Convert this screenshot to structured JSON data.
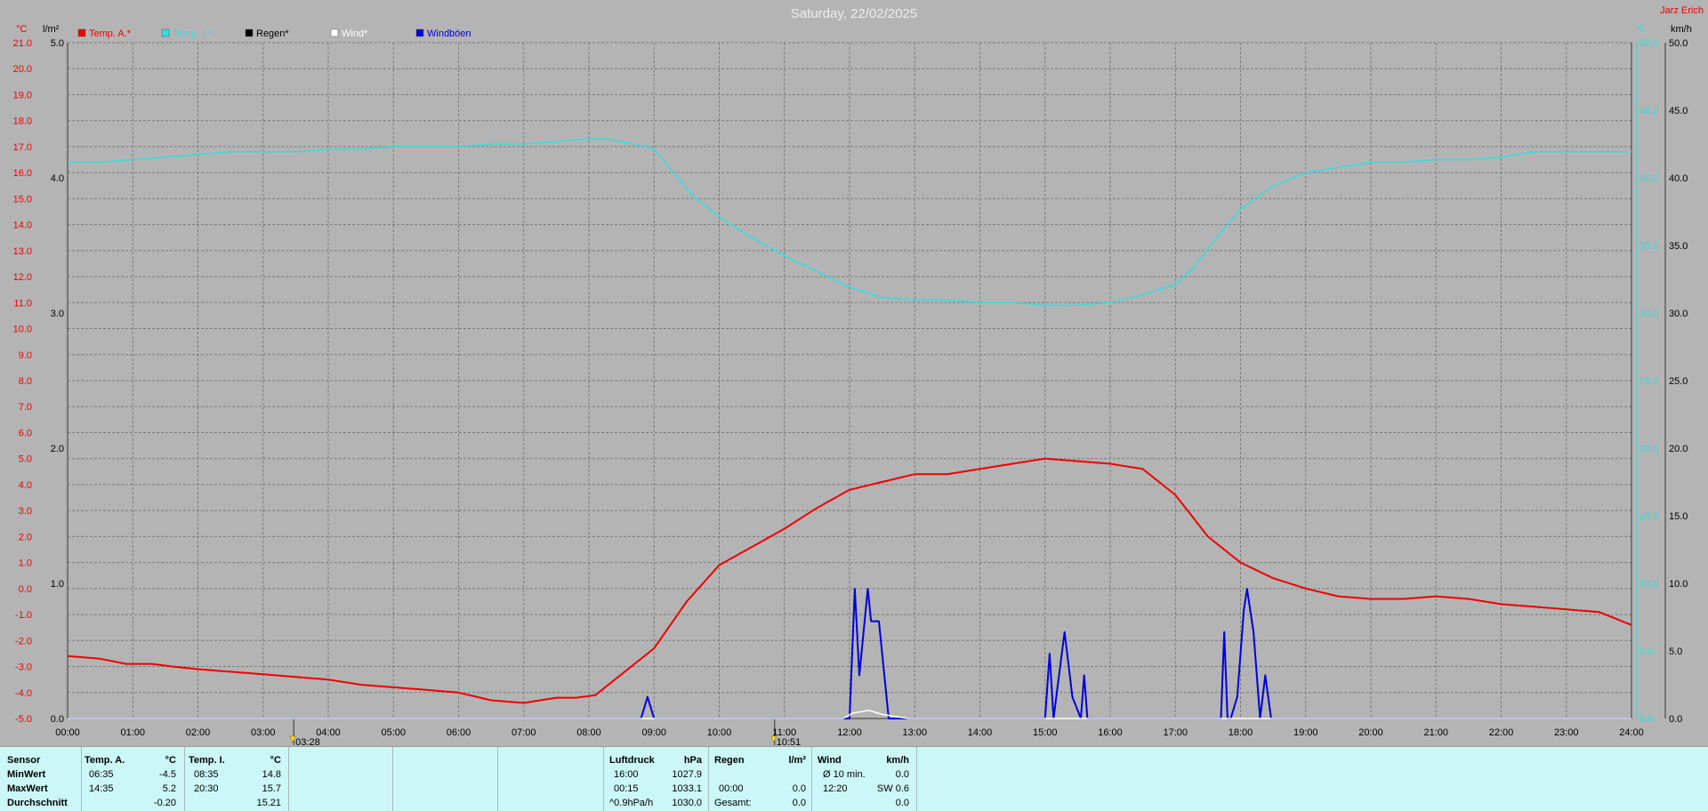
{
  "title": "Saturday, 22/02/2025",
  "corner_label": "Jarz Erich",
  "colors": {
    "background": "#b4b4b4",
    "grid": "#7c7c7c",
    "temp_outdoor": "#ee0000",
    "temp_indoor": "#33dddd",
    "rain": "#000000",
    "wind": "#ffffff",
    "gusts": "#0000dd",
    "stats_panel": "#ccf7f7"
  },
  "chart_data": {
    "type": "line",
    "x_tick_labels": [
      "00:00",
      "01:00",
      "02:00",
      "03:00",
      "04:00",
      "05:00",
      "06:00",
      "07:00",
      "08:00",
      "09:00",
      "10:00",
      "11:00",
      "12:00",
      "13:00",
      "14:00",
      "15:00",
      "16:00",
      "17:00",
      "18:00",
      "19:00",
      "20:00",
      "21:00",
      "22:00",
      "23:00",
      "24:00"
    ],
    "xlim": [
      0,
      24
    ],
    "axes": {
      "temp": {
        "unit": "°C",
        "ylim": [
          -5,
          21
        ],
        "ticks": [
          "21.0",
          "20.0",
          "19.0",
          "18.0",
          "17.0",
          "16.0",
          "15.0",
          "14.0",
          "13.0",
          "12.0",
          "11.0",
          "10.0",
          "9.0",
          "8.0",
          "7.0",
          "6.0",
          "5.0",
          "4.0",
          "3.0",
          "2.0",
          "1.0",
          "0.0",
          "-1.0",
          "-2.0",
          "-3.0",
          "-4.0",
          "-5.0"
        ]
      },
      "rain": {
        "unit": "l/m²",
        "ylim": [
          0,
          5
        ],
        "ticks": [
          "5.0",
          "4.0",
          "3.0",
          "2.0",
          "1.0",
          "0.0"
        ]
      },
      "wind": {
        "unit": "km/h",
        "ylim": [
          0,
          50
        ],
        "ticks": [
          "50.0",
          "45.0",
          "40.0",
          "35.0",
          "30.0",
          "25.0",
          "20.0",
          "15.0",
          "10.0",
          "5.0",
          "0.0"
        ]
      }
    },
    "legend": [
      {
        "name": "Temp. A.*",
        "color": "#ee0000"
      },
      {
        "name": "Temp. I.*",
        "color": "#33dddd"
      },
      {
        "name": "Regen*",
        "color": "#000000"
      },
      {
        "name": "Wind*",
        "color": "#ffffff"
      },
      {
        "name": "Windböen",
        "color": "#0000dd"
      }
    ],
    "events": [
      {
        "x": 3.47,
        "label": "03:28"
      },
      {
        "x": 10.85,
        "label": "10:51"
      }
    ],
    "series": [
      {
        "name": "Temp. A.*",
        "axis": "temp",
        "x": [
          0,
          0.5,
          0.9,
          1.3,
          1.6,
          2,
          2.5,
          3,
          3.5,
          4,
          4.5,
          5,
          5.5,
          6,
          6.5,
          7,
          7.5,
          7.8,
          8.1,
          8.5,
          9,
          9.5,
          10,
          10.5,
          11,
          11.5,
          12,
          12.5,
          13,
          13.5,
          14,
          14.5,
          15,
          15.5,
          16,
          16.5,
          17,
          17.5,
          18,
          18.5,
          19,
          19.5,
          20,
          20.5,
          21,
          21.5,
          22,
          22.5,
          23,
          23.5,
          24
        ],
        "y": [
          -2.6,
          -2.7,
          -2.9,
          -2.9,
          -3.0,
          -3.1,
          -3.2,
          -3.3,
          -3.4,
          -3.5,
          -3.7,
          -3.8,
          -3.9,
          -4.0,
          -4.3,
          -4.4,
          -4.2,
          -4.2,
          -4.1,
          -3.3,
          -2.3,
          -0.5,
          0.9,
          1.6,
          2.3,
          3.1,
          3.8,
          4.1,
          4.4,
          4.4,
          4.6,
          4.8,
          5.0,
          4.9,
          4.8,
          4.6,
          3.6,
          2.0,
          1.0,
          0.4,
          0.0,
          -0.3,
          -0.4,
          -0.4,
          -0.3,
          -0.4,
          -0.6,
          -0.7,
          -0.8,
          -0.9,
          -1.4
        ]
      },
      {
        "name": "Temp. I.*",
        "axis": "temp",
        "x": [
          0,
          0.5,
          1,
          1.5,
          2,
          2.5,
          3,
          3.5,
          4,
          4.5,
          5,
          5.5,
          6,
          6.5,
          7,
          7.5,
          8,
          8.3,
          8.7,
          9,
          9.3,
          9.6,
          10,
          10.5,
          11,
          11.5,
          12,
          12.5,
          13,
          13.5,
          14,
          14.5,
          15,
          15.5,
          16,
          16.5,
          17,
          17.3,
          17.6,
          18,
          18.5,
          19,
          19.5,
          20,
          20.5,
          21,
          21.5,
          22,
          22.5,
          23,
          23.5,
          24
        ],
        "y": [
          16.4,
          16.4,
          16.5,
          16.6,
          16.7,
          16.8,
          16.8,
          16.8,
          16.9,
          16.9,
          17.0,
          17.0,
          17.0,
          17.1,
          17.1,
          17.2,
          17.3,
          17.3,
          17.1,
          16.9,
          16.0,
          15.1,
          14.3,
          13.5,
          12.8,
          12.2,
          11.6,
          11.2,
          11.1,
          11.1,
          11.0,
          11.0,
          10.9,
          10.9,
          11.0,
          11.3,
          11.7,
          12.4,
          13.4,
          14.6,
          15.5,
          16.0,
          16.2,
          16.4,
          16.4,
          16.5,
          16.5,
          16.6,
          16.8,
          16.8,
          16.8,
          16.8
        ]
      },
      {
        "name": "Windböen",
        "axis": "wind",
        "x": [
          0,
          8.8,
          8.9,
          9.0,
          9.1,
          12.0,
          12.08,
          12.15,
          12.28,
          12.33,
          12.45,
          12.6,
          12.7,
          14.0,
          15.0,
          15.07,
          15.13,
          15.3,
          15.42,
          15.55,
          15.6,
          15.65,
          15.75,
          17.7,
          17.75,
          17.8,
          17.85,
          17.95,
          18.05,
          18.1,
          18.2,
          18.3,
          18.38,
          18.47,
          18.55,
          19.0,
          24.0
        ],
        "y": [
          0,
          0,
          1.6,
          0,
          0,
          0,
          9.6,
          3.2,
          9.6,
          7.2,
          7.2,
          0,
          0,
          0,
          0,
          4.8,
          0,
          6.4,
          1.6,
          0,
          3.2,
          0,
          0,
          0,
          6.4,
          0,
          0,
          1.6,
          8.0,
          9.6,
          6.4,
          0,
          3.2,
          0,
          0,
          0,
          0
        ]
      },
      {
        "name": "Wind*",
        "axis": "wind",
        "x": [
          0,
          11.9,
          12.05,
          12.3,
          12.5,
          12.9,
          24
        ],
        "y": [
          0,
          0,
          0.4,
          0.6,
          0.3,
          0,
          0
        ]
      }
    ]
  },
  "stats": {
    "headers": {
      "sensor": "Sensor",
      "temp_a": "Temp. A.",
      "temp_a_unit": "°C",
      "temp_i": "Temp. I.",
      "temp_i_unit": "°C",
      "pressure": "Luftdruck",
      "pressure_unit": "hPa",
      "rain": "Regen",
      "rain_unit": "l/m²",
      "wind": "Wind",
      "wind_unit": "km/h"
    },
    "rows": [
      {
        "label": "MinWert",
        "temp_a_time": "06:35",
        "temp_a": "-4.5",
        "temp_i_time": "08:35",
        "temp_i": "14.8",
        "pressure_time": "16:00",
        "pressure": "1027.9",
        "rain_time": "",
        "rain": "",
        "wind_time": "Ø 10 min.",
        "wind": "0.0"
      },
      {
        "label": "MaxWert",
        "temp_a_time": "14:35",
        "temp_a": "5.2",
        "temp_i_time": "20:30",
        "temp_i": "15.7",
        "pressure_time": "00:15",
        "pressure": "1033.1",
        "rain_time": "00:00",
        "rain": "0.0",
        "wind_time": "12:20",
        "wind": "SW 0.6"
      },
      {
        "label": "Durchschnitt",
        "temp_a_time": "",
        "temp_a": "-0.20",
        "temp_i_time": "",
        "temp_i": "15.21",
        "pressure_time": "^0.9hPa/h",
        "pressure": "1030.0",
        "rain_time": "Gesamt:",
        "rain": "0.0",
        "wind_time": "",
        "wind": "0.0"
      }
    ]
  }
}
